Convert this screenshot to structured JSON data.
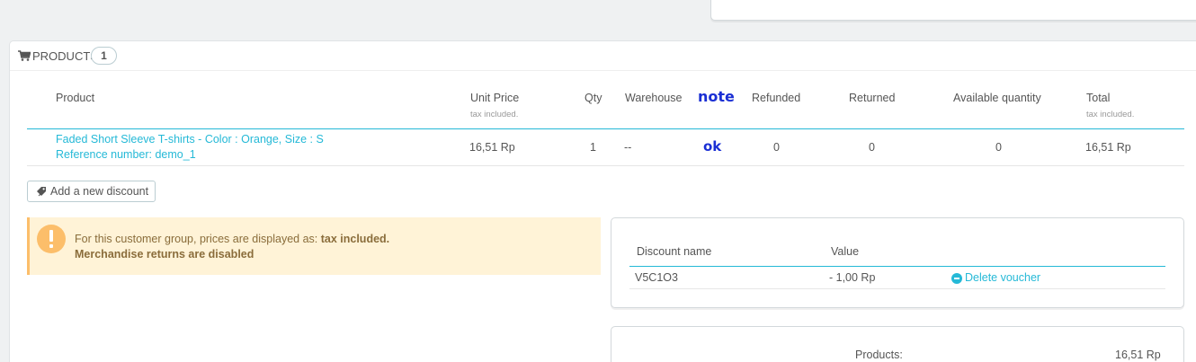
{
  "panel": {
    "title": "PRODUCTS",
    "count": "1"
  },
  "table": {
    "headers": {
      "product": "Product",
      "unit_price": "Unit Price",
      "unit_price_note": "tax included.",
      "qty": "Qty",
      "warehouse": "Warehouse",
      "note": "note",
      "refunded": "Refunded",
      "returned": "Returned",
      "available_quantity": "Available quantity",
      "total": "Total",
      "total_note": "tax included."
    },
    "rows": [
      {
        "product_name": "Faded Short Sleeve T-shirts - Color : Orange, Size : S",
        "reference": "Reference number: demo_1",
        "unit_price": "16,51 Rp",
        "qty": "1",
        "warehouse": "--",
        "note": "ok",
        "refunded": "0",
        "returned": "0",
        "available_quantity": "0",
        "total": "16,51 Rp"
      }
    ]
  },
  "actions": {
    "add_discount_label": "Add a new discount"
  },
  "alert": {
    "line1_prefix": "For this customer group, prices are displayed as: ",
    "line1_strong": "tax included.",
    "line2": "Merchandise returns are disabled"
  },
  "discounts": {
    "headers": {
      "name": "Discount name",
      "value": "Value"
    },
    "rows": [
      {
        "name": "V5C1O3",
        "value": "- 1,00 Rp",
        "delete_label": "Delete voucher"
      }
    ]
  },
  "totals": {
    "products_label": "Products:",
    "products_value": "16,51 Rp"
  },
  "colors": {
    "accent": "#25b9d7",
    "warning_bg": "#fff3d7",
    "warning_border": "#fcbe6a",
    "handwriting": "#1a2fd4"
  },
  "icons": {
    "heading": "shopping-cart-icon",
    "discount_button": "tag-icon",
    "alert": "warning-exclamation-icon",
    "delete_voucher": "minus-circle-icon"
  }
}
